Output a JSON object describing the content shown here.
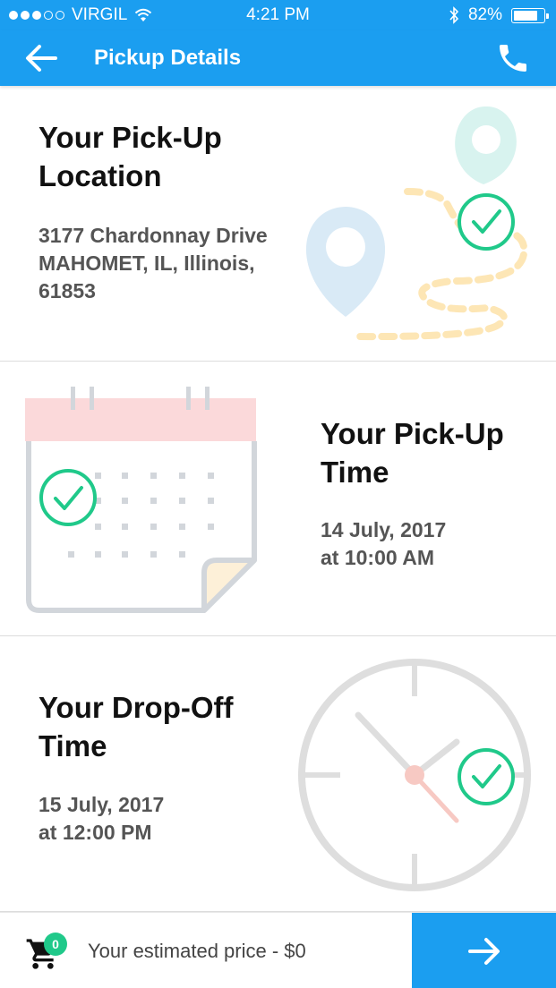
{
  "status_bar": {
    "carrier": "VIRGIL",
    "time": "4:21 PM",
    "battery_percent": "82%",
    "battery_level": 0.82
  },
  "header": {
    "title": "Pickup Details",
    "back_icon": "arrow-left-icon",
    "call_icon": "phone-icon"
  },
  "pickup_location": {
    "heading_line1": "Your Pick-Up",
    "heading_line2": "Location",
    "address_line1": "3177 Chardonnay Drive",
    "address_line2": "MAHOMET, IL, Illinois,",
    "address_line3": "61853"
  },
  "pickup_time": {
    "heading_line1": "Your Pick-Up",
    "heading_line2": "Time",
    "date": "14 July, 2017",
    "time": "at 10:00 AM"
  },
  "dropoff_time": {
    "heading_line1": "Your Drop-Off",
    "heading_line2": "Time",
    "date": "15 July, 2017",
    "time": "at 12:00 PM"
  },
  "footer": {
    "cart_count": "0",
    "estimated_price": "Your estimated price - $0",
    "next_icon": "arrow-right-icon"
  },
  "colors": {
    "brand_blue": "#1b9ef0",
    "check_green": "#20c98a"
  }
}
